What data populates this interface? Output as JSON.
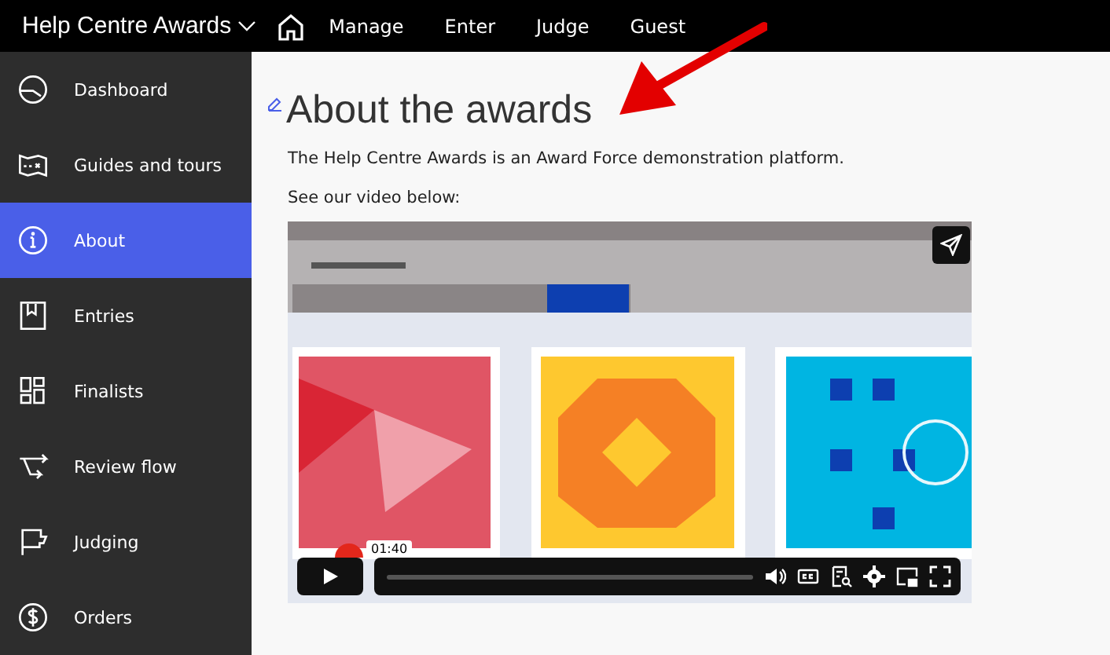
{
  "app": {
    "title": "Help Centre Awards"
  },
  "top_nav": [
    {
      "label": "Manage"
    },
    {
      "label": "Enter"
    },
    {
      "label": "Judge"
    },
    {
      "label": "Guest"
    }
  ],
  "sidebar": {
    "items": [
      {
        "label": "Dashboard",
        "selected": false
      },
      {
        "label": "Guides and tours",
        "selected": false
      },
      {
        "label": "About",
        "selected": true
      },
      {
        "label": "Entries",
        "selected": false
      },
      {
        "label": "Finalists",
        "selected": false
      },
      {
        "label": "Review flow",
        "selected": false
      },
      {
        "label": "Judging",
        "selected": false
      },
      {
        "label": "Orders",
        "selected": false
      }
    ]
  },
  "page": {
    "heading": "About the awards",
    "paragraphs": [
      "The Help Centre Awards is an Award Force demonstration platform.",
      "See our video below:"
    ]
  },
  "video": {
    "hover_time": "01:40"
  }
}
